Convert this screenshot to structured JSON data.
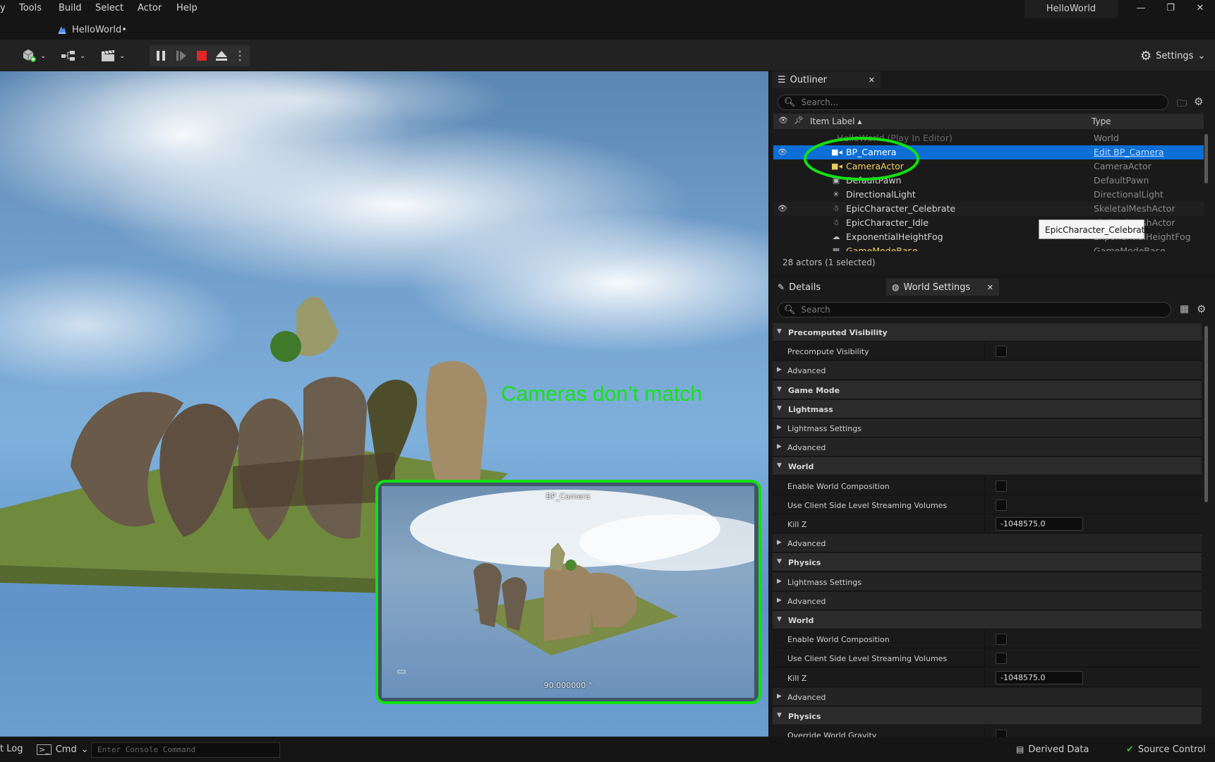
{
  "menu": {
    "items": [
      "Tools",
      "Build",
      "Select",
      "Actor",
      "Help"
    ],
    "project_name": "HelloWorld"
  },
  "window_buttons": {
    "minimize": "—",
    "restore": "❐",
    "close": "✕"
  },
  "doc_tab": {
    "label": "HelloWorld•"
  },
  "toolbar": {
    "settings_label": "Settings"
  },
  "viewport": {
    "annotation": "Cameras don’t match",
    "pip_title": "BP_Camera",
    "pip_fov": "90.000000 °",
    "accent_color": "#11e011"
  },
  "outliner": {
    "tab_label": "Outliner",
    "search_placeholder": "Search...",
    "col_label": "Item Label ▴",
    "col_type": "Type",
    "rows": [
      {
        "label": "HelloWorld (Play In Editor)",
        "type": "World"
      },
      {
        "label": "BP_Camera",
        "type": "Edit BP_Camera"
      },
      {
        "label": "CameraActor",
        "type": "CameraActor"
      },
      {
        "label": "DefaultPawn",
        "type": "DefaultPawn"
      },
      {
        "label": "DirectionalLight",
        "type": "DirectionalLight"
      },
      {
        "label": "EpicCharacter_Celebrate",
        "type": "SkeletalMeshActor"
      },
      {
        "label": "EpicCharacter_Idle",
        "type": "SkeletalMeshActor"
      },
      {
        "label": "ExponentialHeightFog",
        "type": "ExponentialHeightFog"
      },
      {
        "label": "GameModeBase",
        "type": "GameModeBase"
      }
    ],
    "tooltip": "EpicCharacter_Celebrate",
    "count": "28 actors (1 selected)"
  },
  "details": {
    "tab_details": "Details",
    "tab_world_settings": "World Settings",
    "search_placeholder": "Search",
    "rows": [
      {
        "kind": "cat",
        "label": "Precomputed Visibility"
      },
      {
        "kind": "check",
        "label": "Precompute Visibility"
      },
      {
        "kind": "sub",
        "label": "Advanced"
      },
      {
        "kind": "cat",
        "label": "Game Mode"
      },
      {
        "kind": "cat",
        "label": "Lightmass"
      },
      {
        "kind": "sub",
        "label": "Lightmass Settings"
      },
      {
        "kind": "sub",
        "label": "Advanced"
      },
      {
        "kind": "cat",
        "label": "World"
      },
      {
        "kind": "check",
        "label": "Enable World Composition"
      },
      {
        "kind": "check",
        "label": "Use Client Side Level Streaming Volumes"
      },
      {
        "kind": "value",
        "label": "Kill Z",
        "value": "-1048575.0"
      },
      {
        "kind": "sub",
        "label": "Advanced"
      },
      {
        "kind": "cat",
        "label": "Physics"
      },
      {
        "kind": "sub",
        "label": "Lightmass Settings"
      },
      {
        "kind": "sub",
        "label": "Advanced"
      },
      {
        "kind": "cat",
        "label": "World"
      },
      {
        "kind": "check",
        "label": "Enable World Composition"
      },
      {
        "kind": "check",
        "label": "Use Client Side Level Streaming Volumes"
      },
      {
        "kind": "value",
        "label": "Kill Z",
        "value": "-1048575.0"
      },
      {
        "kind": "sub",
        "label": "Advanced"
      },
      {
        "kind": "cat",
        "label": "Physics"
      },
      {
        "kind": "check",
        "label": "Override World Gravity"
      }
    ]
  },
  "statusbar": {
    "log_label": "t Log",
    "cmd_label": "Cmd",
    "console_placeholder": "Enter Console Command",
    "derived_data": "Derived Data",
    "source_control": "Source Control"
  }
}
